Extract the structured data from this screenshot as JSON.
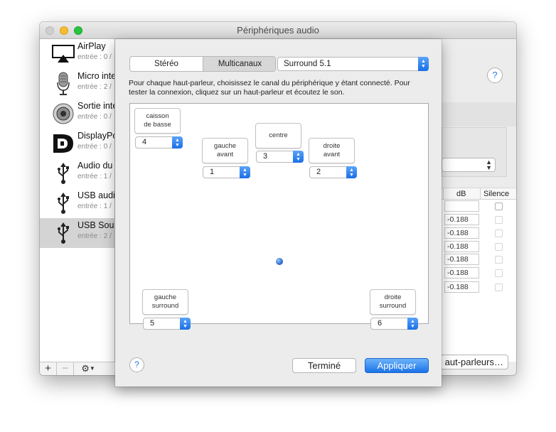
{
  "window": {
    "title": "Périphériques audio"
  },
  "sidebar": {
    "devices": [
      {
        "name": "AirPlay",
        "sub": "entrée : 0 /",
        "icon": "airplay-icon"
      },
      {
        "name": "Micro inte",
        "sub": "entrée : 2 /",
        "icon": "microphone-icon"
      },
      {
        "name": "Sortie inte",
        "sub": "entrée : 0 /",
        "icon": "speaker-icon"
      },
      {
        "name": "DisplayPo",
        "sub": "entrée : 0 /",
        "icon": "displayport-icon"
      },
      {
        "name": "Audio du",
        "sub": "entrée : 1 /",
        "icon": "usb-icon"
      },
      {
        "name": "USB audi",
        "sub": "entrée : 1 /",
        "icon": "usb-icon"
      },
      {
        "name": "USB Sou",
        "sub": "entrée : 2 /",
        "icon": "usb-icon",
        "selected": true
      }
    ],
    "add_label": "+",
    "remove_label": "−",
    "gear_label": "⚙"
  },
  "main": {
    "help_label": "?",
    "table": {
      "col_db": "dB",
      "col_silence": "Silence",
      "db_values": [
        "",
        "-0.188",
        "-0.188",
        "-0.188",
        "-0.188",
        "-0.188",
        "-0.188"
      ]
    },
    "configure_button": "aut-parleurs…"
  },
  "sheet": {
    "tabs": {
      "stereo": "Stéréo",
      "multichannel": "Multicanaux",
      "active": "multichannel"
    },
    "surround_select": "Surround 5.1",
    "instructions": "Pour chaque haut-parleur, choisissez le canal du périphérique y étant connecté. Pour tester la connexion, cliquez sur un haut-parleur et écoutez le son.",
    "speakers": {
      "subwoofer": {
        "label": "caisson de basse",
        "channel": "4"
      },
      "front_left": {
        "label": "gauche avant",
        "channel": "1"
      },
      "center": {
        "label": "centre",
        "channel": "3"
      },
      "front_right": {
        "label": "droite avant",
        "channel": "2"
      },
      "surround_left": {
        "label": "gauche surround",
        "channel": "5"
      },
      "surround_right": {
        "label": "droite surround",
        "channel": "6"
      }
    },
    "help_label": "?",
    "done_label": "Terminé",
    "apply_label": "Appliquer"
  },
  "colors": {
    "accent": "#1b73e8",
    "selection": "#d4d4d4",
    "help_blue": "#2a7ae2"
  }
}
